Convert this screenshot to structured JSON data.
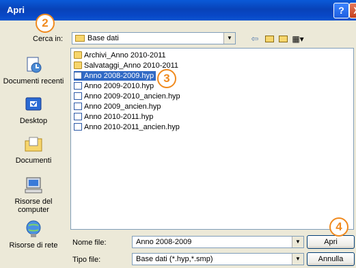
{
  "window": {
    "title": "Apri",
    "help_label": "?",
    "close_label": "X"
  },
  "callouts": {
    "c2": "2",
    "c3": "3",
    "c4": "4"
  },
  "lookin": {
    "label": "Cerca in:",
    "value": "Base dati"
  },
  "places": [
    {
      "label": "Documenti recenti",
      "icon": "recent-documents-icon"
    },
    {
      "label": "Desktop",
      "icon": "desktop-icon"
    },
    {
      "label": "Documenti",
      "icon": "my-documents-icon"
    },
    {
      "label": "Risorse del computer",
      "icon": "my-computer-icon"
    },
    {
      "label": "Risorse di rete",
      "icon": "network-icon"
    }
  ],
  "files": [
    {
      "name": "Archivi_Anno 2010-2011",
      "type": "folder"
    },
    {
      "name": "Salvataggi_Anno 2010-2011",
      "type": "folder"
    },
    {
      "name": "Anno 2008-2009.hyp",
      "type": "file",
      "selected": true
    },
    {
      "name": "Anno 2009-2010.hyp",
      "type": "file"
    },
    {
      "name": "Anno 2009-2010_ancien.hyp",
      "type": "file"
    },
    {
      "name": "Anno 2009_ancien.hyp",
      "type": "file"
    },
    {
      "name": "Anno 2010-2011.hyp",
      "type": "file"
    },
    {
      "name": "Anno 2010-2011_ancien.hyp",
      "type": "file"
    }
  ],
  "filename": {
    "label": "Nome file:",
    "value": "Anno 2008-2009"
  },
  "filetype": {
    "label": "Tipo file:",
    "value": "Base dati (*.hyp,*.smp)"
  },
  "buttons": {
    "open": "Apri",
    "cancel": "Annulla"
  },
  "colors": {
    "titlebar": "#0842b8",
    "selection": "#316ac5",
    "callout": "#f08a1e"
  }
}
